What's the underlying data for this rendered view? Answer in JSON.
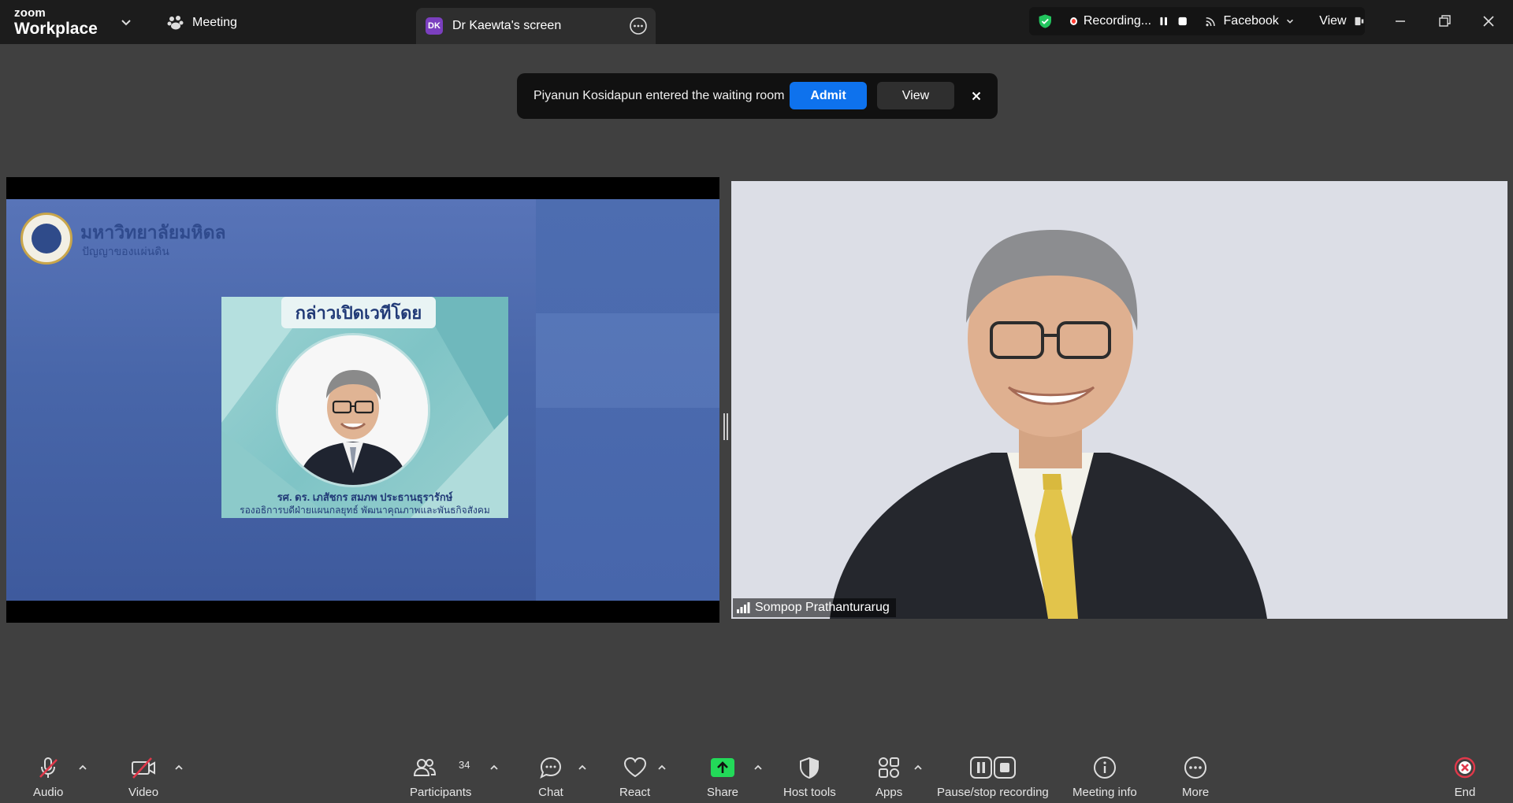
{
  "app": {
    "logo_top": "zoom",
    "logo_bottom": "Workplace"
  },
  "tabs": {
    "meeting": "Meeting",
    "screen_badge": "DK",
    "screen": "Dr Kaewta's screen"
  },
  "recording": {
    "status": "Recording...",
    "stream_target": "Facebook",
    "view": "View"
  },
  "notification": {
    "message": "Piyanun Kosidapun entered the waiting room",
    "admit": "Admit",
    "view": "View"
  },
  "slide": {
    "university_name": "มหาวิทยาลัยมหิดล",
    "university_sub": "ปัญญาของแผ่นดิน",
    "card_title": "กล่าวเปิดเวทีโดย",
    "speaker_name": "รศ. ดร. เภสัชกร สมภพ ประธานธุรารักษ์",
    "speaker_role": "รองอธิการบดีฝ่ายแผนกลยุทธ์ พัฒนาคุณภาพและพันธกิจสังคม"
  },
  "video": {
    "participant_name": "Sompop Prathanturarug"
  },
  "toolbar": {
    "audio": "Audio",
    "video": "Video",
    "participants": "Participants",
    "participant_count": "34",
    "chat": "Chat",
    "react": "React",
    "share": "Share",
    "host_tools": "Host tools",
    "apps": "Apps",
    "pause_stop_recording": "Pause/stop recording",
    "meeting_info": "Meeting info",
    "more": "More",
    "end": "End"
  },
  "colors": {
    "admit_blue": "#0e72ed",
    "share_green": "#23d959",
    "end_red": "#e0384a",
    "recording_red": "#ff3b30",
    "shield_green": "#22c55e"
  }
}
